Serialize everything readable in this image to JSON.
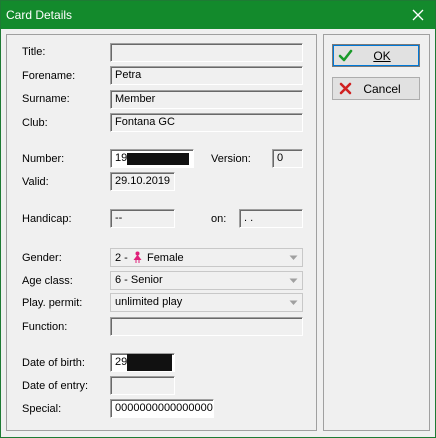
{
  "window": {
    "title": "Card Details",
    "close_glyph": "✕"
  },
  "form": {
    "title": {
      "label": "Title:",
      "value": ""
    },
    "forename": {
      "label": "Forename:",
      "value": "Petra"
    },
    "surname": {
      "label": "Surname:",
      "value": "Member"
    },
    "club": {
      "label": "Club:",
      "value": "Fontana GC"
    },
    "number": {
      "label": "Number:",
      "value": "19"
    },
    "version": {
      "label": "Version:",
      "value": "0"
    },
    "valid": {
      "label": "Valid:",
      "value": "29.10.2019"
    },
    "handicap": {
      "label": "Handicap:",
      "value": "--"
    },
    "on": {
      "label": "on:",
      "value": " .  ."
    },
    "gender": {
      "label": "Gender:",
      "value_prefix": "2 -",
      "value": "Female",
      "icon": "female-symbol-icon"
    },
    "age_class": {
      "label": "Age class:",
      "value": "6 - Senior"
    },
    "play_permit": {
      "label": "Play. permit:",
      "value": "unlimited play"
    },
    "function": {
      "label": "Function:",
      "value": ""
    },
    "date_of_birth": {
      "label": "Date of birth:",
      "value": "29"
    },
    "date_of_entry": {
      "label": "Date of entry:",
      "value": ""
    },
    "special": {
      "label": "Special:",
      "value": "0000000000000000"
    }
  },
  "buttons": {
    "ok": {
      "label": "OK",
      "icon": "checkmark-icon"
    },
    "cancel": {
      "label": "Cancel",
      "icon": "cross-icon"
    }
  },
  "colors": {
    "titlebar": "#138a2c",
    "ok_icon": "#1a9a2a",
    "cancel_icon": "#d02020",
    "female_icon": "#e0207a"
  }
}
